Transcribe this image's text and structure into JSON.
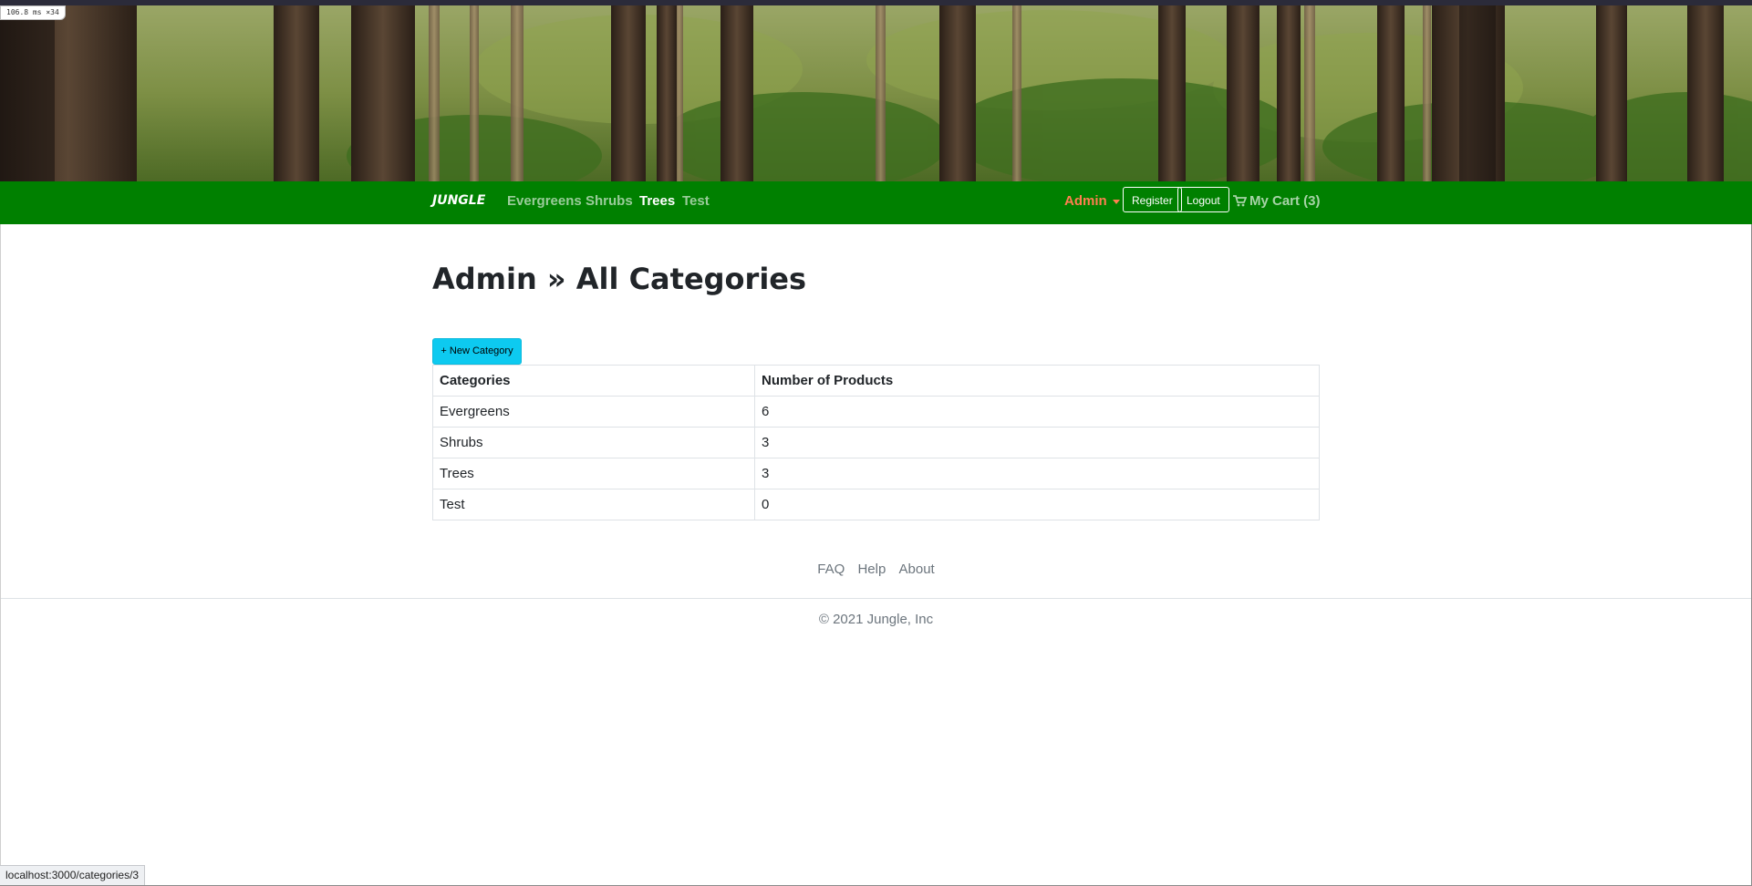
{
  "devtools": {
    "perf_text": "106.8 ms ×34"
  },
  "navbar": {
    "brand": "JUNGLE",
    "links": [
      "Evergreens",
      "Shrubs",
      "Trees",
      "Test"
    ],
    "active_link": "Trees",
    "admin_label": "Admin",
    "register_label": "Register",
    "logout_label": "Logout",
    "cart_label": "My Cart (3)",
    "colors": {
      "bar": "#008000",
      "admin": "#ff7f50"
    }
  },
  "page": {
    "title": "Admin » All Categories",
    "new_button_label": "+ New Category",
    "new_button_color": "#0dcaf0"
  },
  "table": {
    "headers": [
      "Categories",
      "Number of Products"
    ],
    "rows": [
      [
        "Evergreens",
        "6"
      ],
      [
        "Shrubs",
        "3"
      ],
      [
        "Trees",
        "3"
      ],
      [
        "Test",
        "0"
      ]
    ]
  },
  "footer": {
    "links": [
      "FAQ",
      "Help",
      "About"
    ],
    "copyright": "© 2021 Jungle, Inc"
  },
  "status_bar": {
    "url": "localhost:3000/categories/3"
  }
}
